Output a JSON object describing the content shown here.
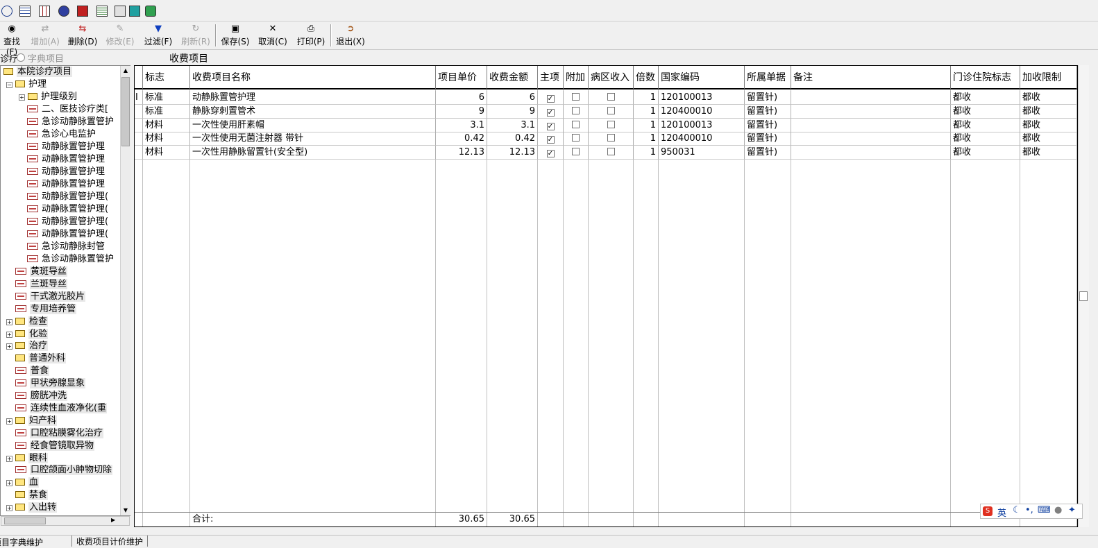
{
  "quick_icons": [
    "magnifier-icon",
    "calendar-icon",
    "table-icon",
    "gear-icon",
    "red-book-icon",
    "report-icon",
    "chart-doc-icon",
    "excel-icon",
    "book-stack-icon"
  ],
  "toolbar": {
    "find": "查找(F)",
    "add": "增加(A)",
    "delete": "删除(D)",
    "modify": "修改(E)",
    "filter": "过滤(F)",
    "refresh": "刷新(R)",
    "save": "保存(S)",
    "cancel": "取消(C)",
    "print": "打印(P)",
    "exit": "退出(X)"
  },
  "subheader": {
    "left_option": "诊疗",
    "radio_option": "字典项目",
    "grid_title": "收费项目"
  },
  "tree": {
    "root": "本院诊疗项目",
    "nursing": "护理",
    "nursing_level": "护理级别",
    "items_l2": [
      "二、医技诊疗类[",
      "急诊动静脉置管护",
      "急诊心电监护",
      "动静脉置管护理",
      "动静脉置管护理",
      "动静脉置管护理",
      "动静脉置管护理",
      "动静脉置管护理(",
      "动静脉置管护理(",
      "动静脉置管护理(",
      "动静脉置管护理(",
      "急诊动静脉封管",
      "急诊动静脉置管护"
    ],
    "items_l1": [
      {
        "label": "黄斑导丝",
        "type": "doc",
        "expand": false
      },
      {
        "label": "兰斑导丝",
        "type": "doc",
        "expand": false
      },
      {
        "label": "干式激光胶片",
        "type": "doc",
        "expand": false
      },
      {
        "label": "专用培养管",
        "type": "doc",
        "expand": false
      },
      {
        "label": "检查",
        "type": "folder",
        "expand": true
      },
      {
        "label": "化验",
        "type": "folder",
        "expand": true
      },
      {
        "label": "治疗",
        "type": "folder",
        "expand": true
      },
      {
        "label": "普通外科",
        "type": "folder",
        "expand": false
      },
      {
        "label": "普食",
        "type": "doc",
        "expand": false
      },
      {
        "label": "甲状旁腺显象",
        "type": "doc",
        "expand": false
      },
      {
        "label": "膀胱冲洗",
        "type": "doc",
        "expand": false
      },
      {
        "label": "连续性血液净化(重",
        "type": "doc",
        "expand": false
      },
      {
        "label": "妇产科",
        "type": "folder",
        "expand": true
      },
      {
        "label": "口腔粘膜雾化治疗",
        "type": "doc",
        "expand": false
      },
      {
        "label": "经食管镜取异物",
        "type": "doc",
        "expand": false
      },
      {
        "label": "眼科",
        "type": "folder",
        "expand": true
      },
      {
        "label": "口腔颌面小肿物切除",
        "type": "doc",
        "expand": false
      },
      {
        "label": "血",
        "type": "folder",
        "expand": true
      },
      {
        "label": "禁食",
        "type": "folder",
        "expand": false
      },
      {
        "label": "入出转",
        "type": "folder",
        "expand": true
      }
    ]
  },
  "grid": {
    "columns": [
      "标志",
      "收费项目名称",
      "项目单价",
      "收费金额",
      "主项",
      "附加",
      "病区收入",
      "倍数",
      "国家编码",
      "所属单据",
      "备注",
      "门诊住院标志",
      "加收限制"
    ],
    "row_indicator": "I",
    "rows": [
      {
        "flag": "标准",
        "name": "动静脉置管护理",
        "price": "6",
        "amount": "6",
        "main": true,
        "extra": false,
        "ward": false,
        "mult": "1",
        "code": "120100013",
        "bill": "留置针)",
        "note": "",
        "op": "都收",
        "limit": "都收"
      },
      {
        "flag": "标准",
        "name": "静脉穿刺置管术",
        "price": "9",
        "amount": "9",
        "main": true,
        "extra": false,
        "ward": false,
        "mult": "1",
        "code": "120400010",
        "bill": "留置针)",
        "note": "",
        "op": "都收",
        "limit": "都收"
      },
      {
        "flag": "材料",
        "name": "一次性使用肝素帽",
        "price": "3.1",
        "amount": "3.1",
        "main": true,
        "extra": false,
        "ward": false,
        "mult": "1",
        "code": "120100013",
        "bill": "留置针)",
        "note": "",
        "op": "都收",
        "limit": "都收"
      },
      {
        "flag": "材料",
        "name": "一次性使用无菌注射器 带针",
        "price": "0.42",
        "amount": "0.42",
        "main": true,
        "extra": false,
        "ward": false,
        "mult": "1",
        "code": "120400010",
        "bill": "留置针)",
        "note": "",
        "op": "都收",
        "limit": "都收"
      },
      {
        "flag": "材料",
        "name": "一次性用静脉留置针(安全型)",
        "price": "12.13",
        "amount": "12.13",
        "main": true,
        "extra": false,
        "ward": false,
        "mult": "1",
        "code": "950031",
        "bill": "留置针)",
        "note": "",
        "op": "都收",
        "limit": "都收"
      }
    ],
    "footer": {
      "label": "合计:",
      "price_total": "30.65",
      "amount_total": "30.65"
    }
  },
  "ime": {
    "lang": "英"
  },
  "statusbar": {
    "tab1": "项目字典维护",
    "tab2": "收费项目计价维护"
  }
}
